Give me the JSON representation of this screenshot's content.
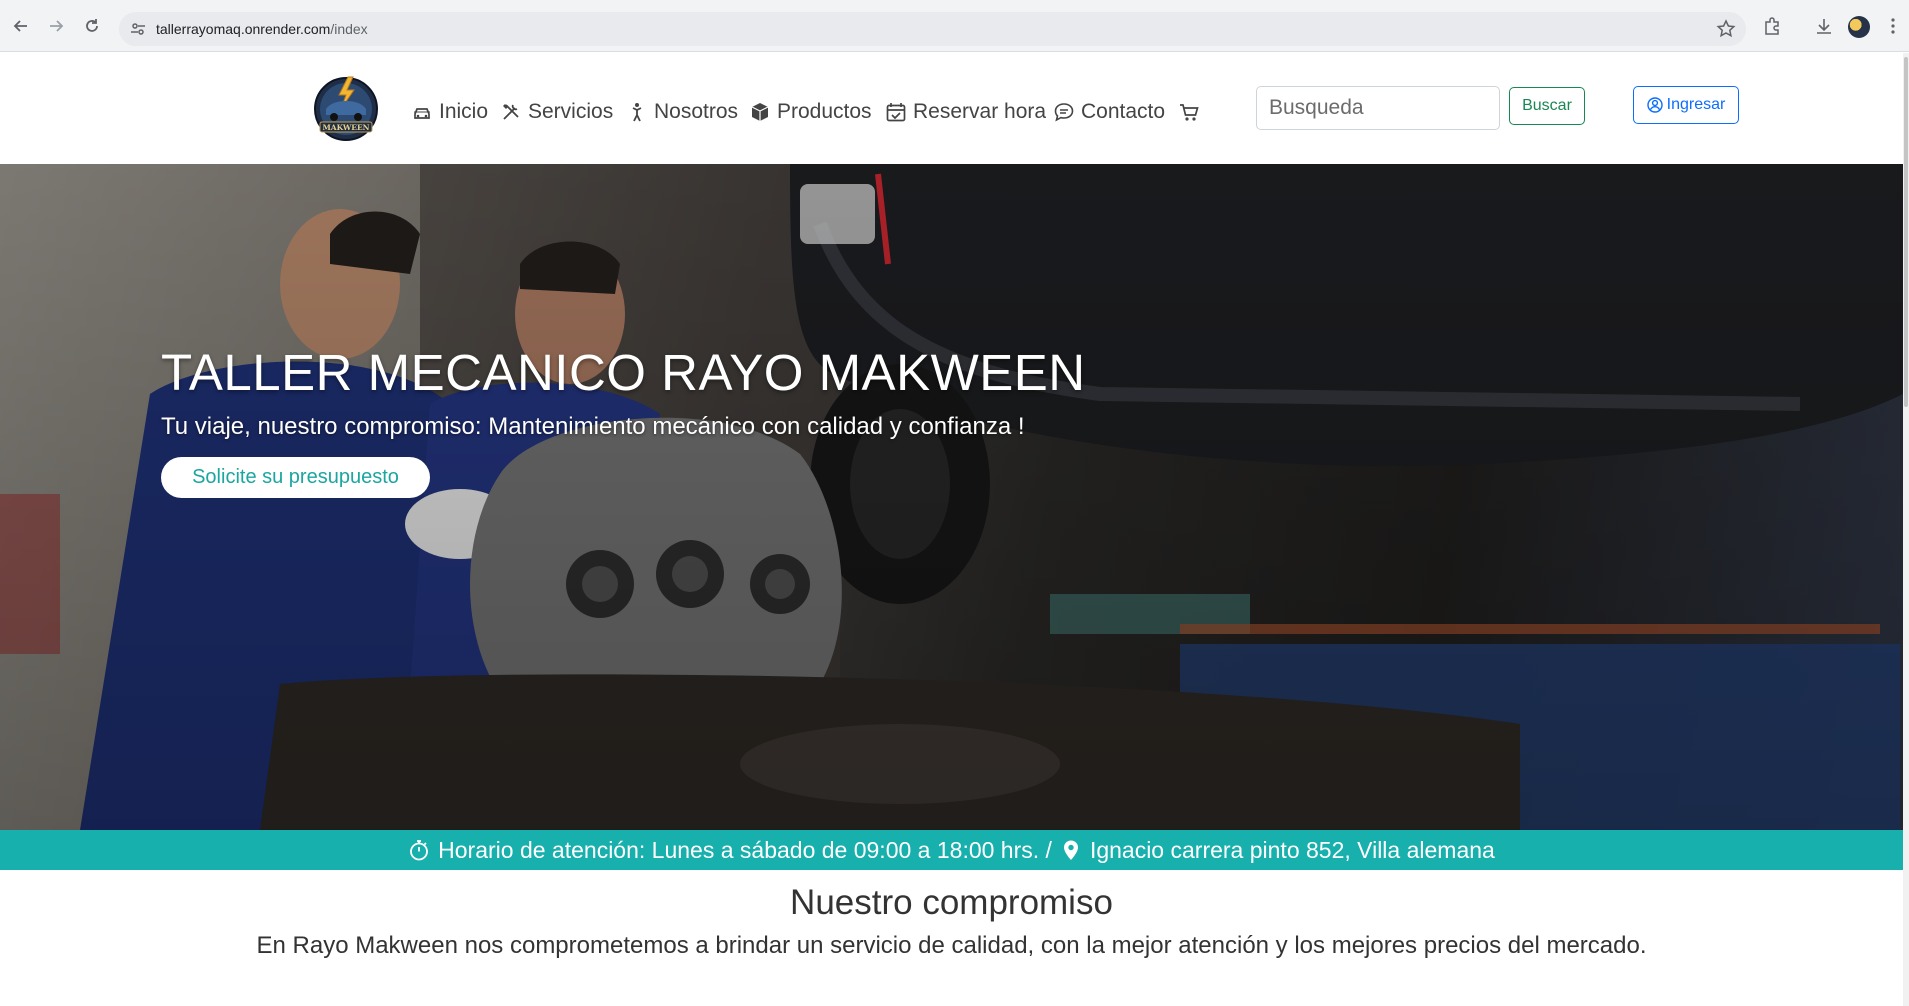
{
  "browser": {
    "url_host": "tallerrayomaq.onrender.com",
    "url_path": "/index"
  },
  "navbar": {
    "logo_text": "MAKWEEN",
    "items": [
      {
        "label": "Inicio",
        "icon": "car-icon"
      },
      {
        "label": "Servicios",
        "icon": "tools-icon"
      },
      {
        "label": "Nosotros",
        "icon": "person-icon"
      },
      {
        "label": "Productos",
        "icon": "box-icon"
      },
      {
        "label": "Reservar hora",
        "icon": "calendar-check-icon"
      },
      {
        "label": "Contacto",
        "icon": "chat-icon"
      }
    ],
    "cart_icon": "cart-icon",
    "search_placeholder": "Busqueda",
    "search_button": "Buscar",
    "login_button": "Ingresar"
  },
  "hero": {
    "title": "TALLER MECANICO RAYO MAKWEEN",
    "subtitle": "Tu viaje, nuestro compromiso: Mantenimiento mecánico con calidad y confianza !",
    "cta": "Solicite su presupuesto"
  },
  "info_bar": {
    "hours": "Horario de atención: Lunes a sábado de 09:00 a 18:00 hrs. /",
    "address": "Ignacio carrera pinto 852, Villa alemana"
  },
  "commitment": {
    "title": "Nuestro compromiso",
    "text": "En Rayo Makween nos comprometemos a brindar un servicio de calidad, con la mejor atención y los mejores precios del mercado."
  },
  "colors": {
    "accent_teal": "#17b0ad",
    "search_green": "#198754",
    "login_blue": "#0d6efd"
  }
}
